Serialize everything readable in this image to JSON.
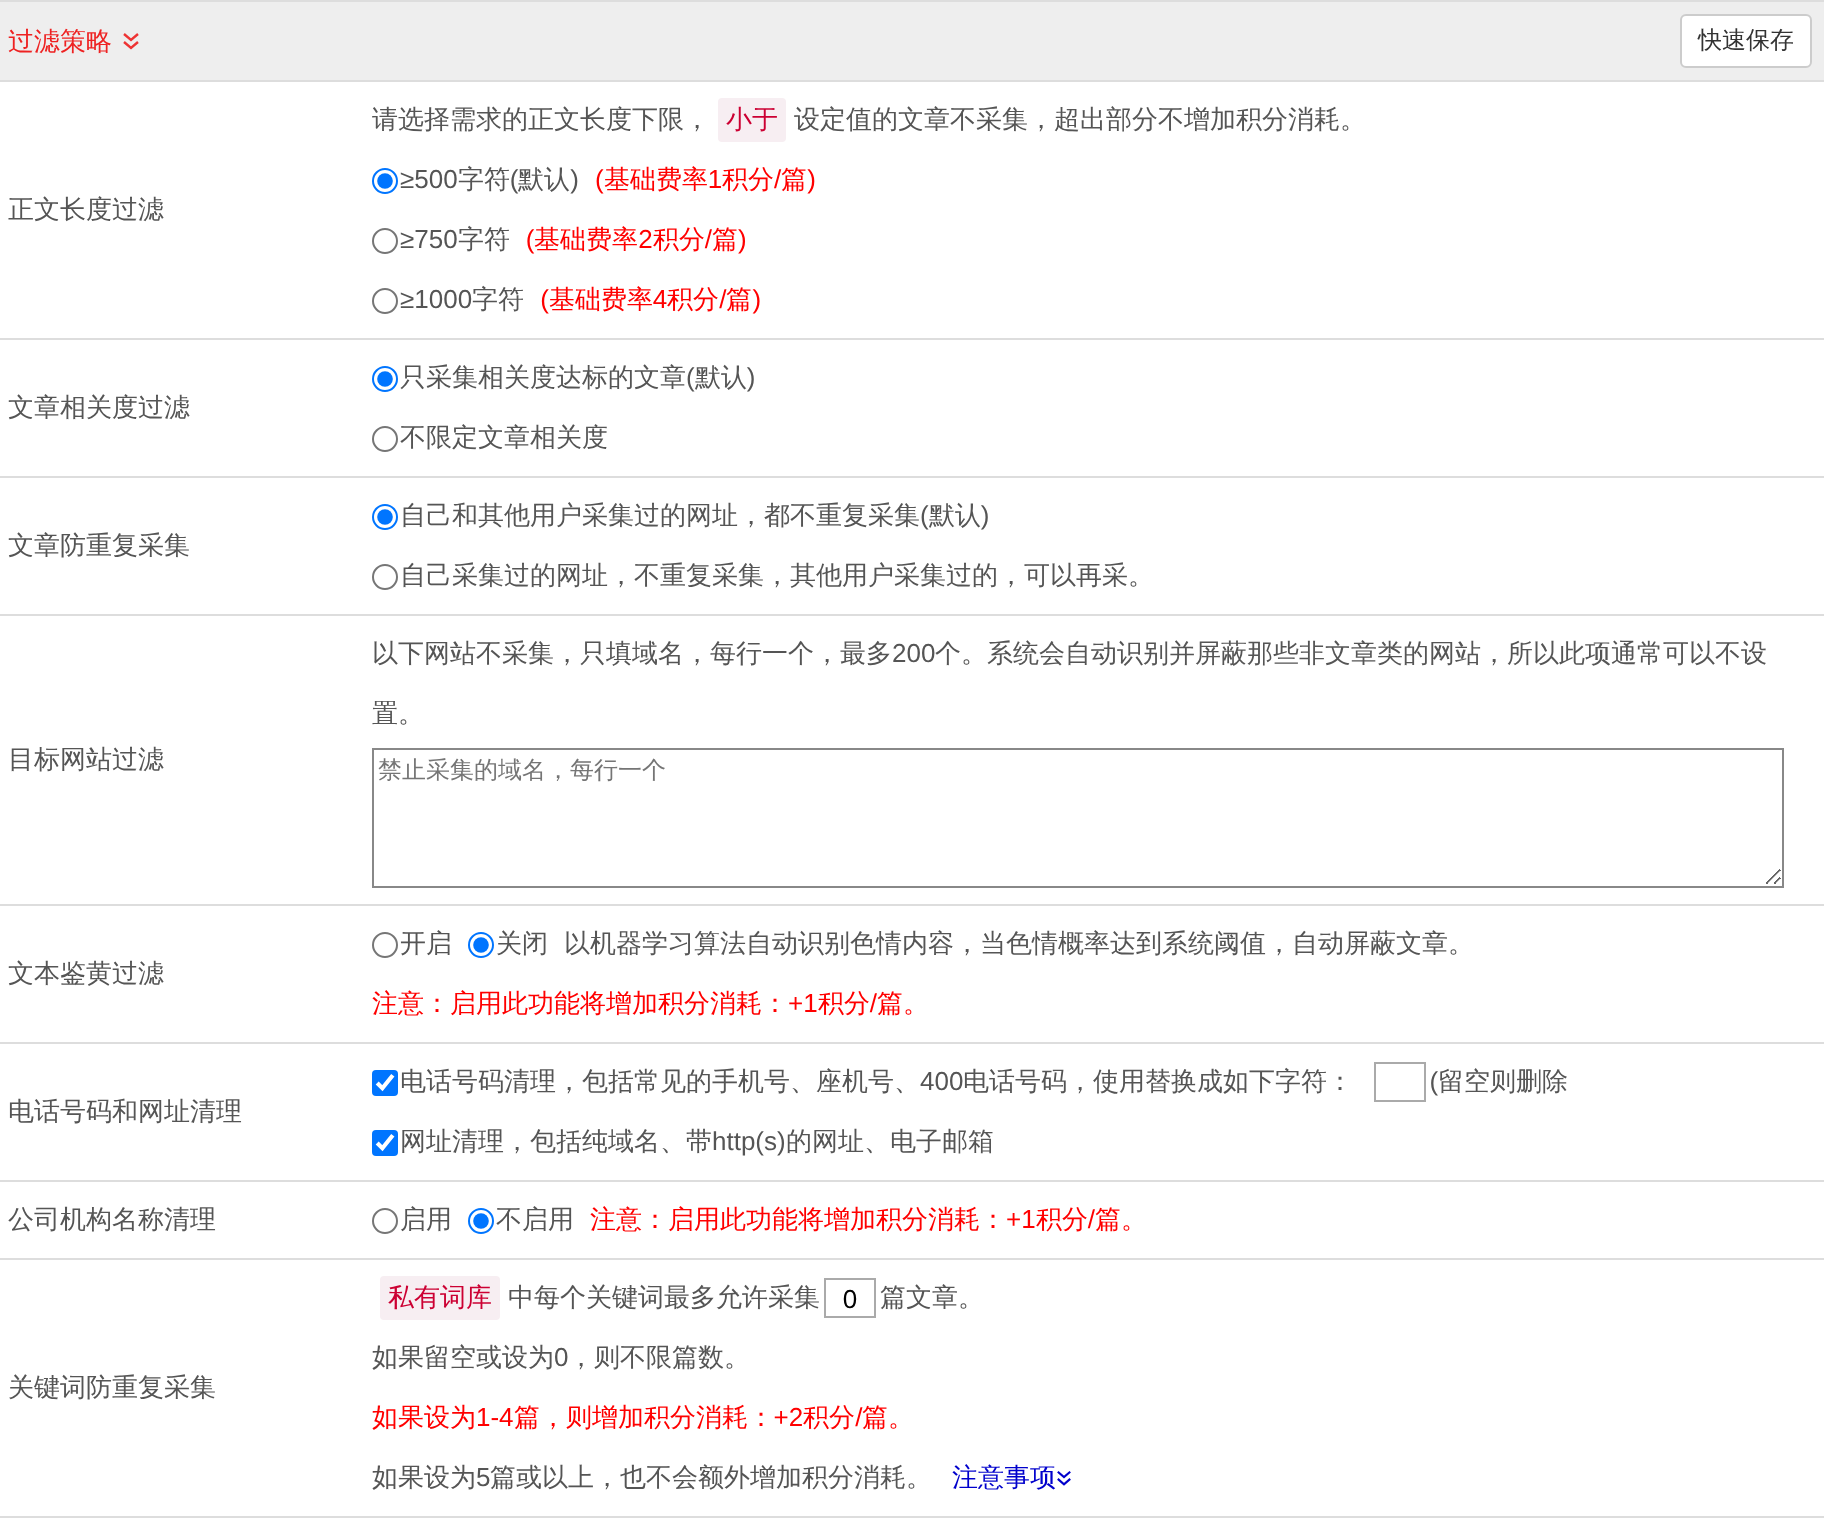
{
  "header": {
    "title": "过滤策略",
    "button": "快速保存"
  },
  "rows": [
    {
      "label": "正文长度过滤",
      "lines": [
        [
          {
            "kind": "text",
            "text": "请选择需求的正文长度下限，"
          },
          {
            "kind": "tag",
            "text": "小于"
          },
          {
            "kind": "text",
            "text": "设定值的文章不采集，超出部分不增加积分消耗。"
          }
        ],
        [
          {
            "kind": "radio",
            "label": "≥500字符(默认)",
            "selected": true
          },
          {
            "kind": "text",
            "text": "(基础费率1积分/篇)",
            "warning": true
          }
        ],
        [
          {
            "kind": "radio",
            "label": "≥750字符",
            "selected": false
          },
          {
            "kind": "text",
            "text": "(基础费率2积分/篇)",
            "warning": true
          }
        ],
        [
          {
            "kind": "radio",
            "label": "≥1000字符",
            "selected": false
          },
          {
            "kind": "text",
            "text": "(基础费率4积分/篇)",
            "warning": true
          }
        ]
      ]
    },
    {
      "label": "文章相关度过滤",
      "lines": [
        [
          {
            "kind": "radio",
            "label": "只采集相关度达标的文章(默认)",
            "selected": true
          }
        ],
        [
          {
            "kind": "radio",
            "label": "不限定文章相关度",
            "selected": false
          }
        ]
      ]
    },
    {
      "label": "文章防重复采集",
      "lines": [
        [
          {
            "kind": "radio",
            "label": "自己和其他用户采集过的网址，都不重复采集(默认)",
            "selected": true
          }
        ],
        [
          {
            "kind": "radio",
            "label": "自己采集过的网址，不重复采集，其他用户采集过的，可以再采。",
            "selected": false
          }
        ]
      ]
    },
    {
      "label": "目标网站过滤",
      "lines": [
        [
          {
            "kind": "text",
            "text": "以下网站不采集，只填域名，每行一个，最多200个。系统会自动识别并屏蔽那些非文章类的网站，所以此项通常可以不设置。"
          }
        ],
        [
          {
            "kind": "textarea",
            "placeholder": "禁止采集的域名，每行一个"
          }
        ]
      ]
    },
    {
      "label": "文本鉴黄过滤",
      "lines": [
        [
          {
            "kind": "radio",
            "label": "开启",
            "selected": false
          },
          {
            "kind": "radio",
            "label": "关闭",
            "selected": true
          },
          {
            "kind": "text",
            "text": "以机器学习算法自动识别色情内容，当色情概率达到系统阈值，自动屏蔽文章。"
          }
        ],
        [
          {
            "kind": "text",
            "text": "注意：启用此功能将增加积分消耗：+1积分/篇。",
            "warning": true
          }
        ]
      ]
    },
    {
      "label": "电话号码和网址清理",
      "lines": [
        [
          {
            "kind": "checkbox",
            "label": "电话号码清理，包括常见的手机号、座机号、400电话号码，使用替换成如下字符：",
            "checked": true
          },
          {
            "kind": "input"
          },
          {
            "kind": "text",
            "text": "(留空则删除"
          }
        ],
        [
          {
            "kind": "checkbox",
            "label": "网址清理，包括纯域名、带http(s)的网址、电子邮箱",
            "checked": true
          }
        ]
      ]
    },
    {
      "label": "公司机构名称清理",
      "lines": [
        [
          {
            "kind": "radio",
            "label": "启用",
            "selected": false
          },
          {
            "kind": "radio",
            "label": "不启用",
            "selected": true
          },
          {
            "kind": "text",
            "text": "注意：启用此功能将增加积分消耗：+1积分/篇。",
            "warning": true
          }
        ]
      ]
    },
    {
      "label": "关键词防重复采集",
      "lines": [
        [
          {
            "kind": "tag",
            "text": "私有词库"
          },
          {
            "kind": "text",
            "text": "中每个关键词最多允许采集"
          },
          {
            "kind": "input",
            "value": "0"
          },
          {
            "kind": "text",
            "text": "篇文章。"
          }
        ],
        [
          {
            "kind": "text",
            "text": "如果留空或设为0，则不限篇数。"
          }
        ],
        [
          {
            "kind": "text",
            "text": "如果设为1-4篇，则增加积分消耗：+2积分/篇。",
            "warning": true
          }
        ],
        [
          {
            "kind": "text",
            "text": "如果设为5篇或以上，也不会额外增加积分消耗。"
          },
          {
            "kind": "link",
            "text": "注意事项"
          }
        ]
      ]
    }
  ]
}
